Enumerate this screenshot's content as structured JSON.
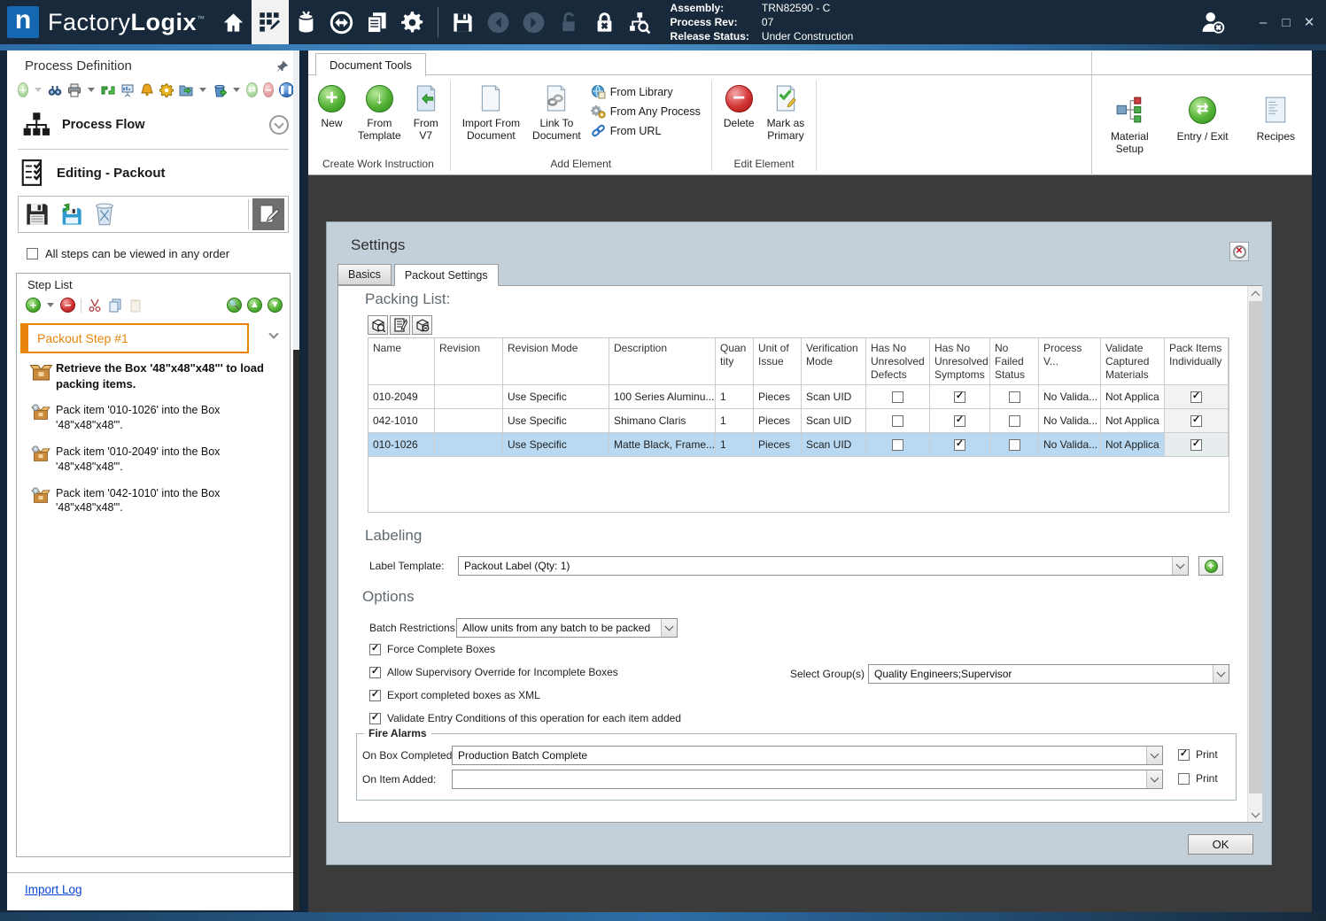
{
  "titlebar": {
    "brand_light": "Factory",
    "brand_bold": "Logix",
    "brand_tm": "™",
    "logo_letter": "n",
    "assembly_label": "Assembly:",
    "assembly_value": "TRN82590 - C",
    "process_rev_label": "Process Rev:",
    "process_rev_value": "07",
    "release_status_label": "Release Status:",
    "release_status_value": "Under Construction",
    "minimize_glyph": "–",
    "maximize_glyph": "□",
    "close_glyph": "✕"
  },
  "ribbon": {
    "tab_label": "Document Tools",
    "groups": [
      {
        "label": "Create Work Instruction",
        "buttons": [
          {
            "label": "New"
          },
          {
            "label": "From\nTemplate"
          },
          {
            "label": "From\nV7"
          }
        ]
      },
      {
        "label": "Add Element",
        "buttons": [
          {
            "label": "Import From\nDocument"
          },
          {
            "label": "Link To\nDocument"
          }
        ],
        "menu_items": [
          {
            "label": "From Library"
          },
          {
            "label": "From Any Process"
          },
          {
            "label": "From URL"
          }
        ]
      },
      {
        "label": "Edit Element",
        "buttons": [
          {
            "label": "Delete"
          },
          {
            "label": "Mark as\nPrimary"
          }
        ]
      }
    ],
    "right_buttons": [
      {
        "label": "Material\nSetup"
      },
      {
        "label": "Entry / Exit"
      },
      {
        "label": "Recipes"
      }
    ]
  },
  "left_panel": {
    "title": "Process Definition",
    "process_flow_label": "Process Flow",
    "editing_label": "Editing - Packout",
    "all_steps_checkbox_label": "All steps can be viewed in any order",
    "all_steps_checked": false,
    "step_list": {
      "title": "Step List",
      "selected_step": "Packout Step #1",
      "items": [
        {
          "icon": "retrieve-box-icon",
          "bold": true,
          "text": "Retrieve the Box '48\"x48\"x48\"' to load packing items."
        },
        {
          "icon": "pack-item-icon",
          "bold": false,
          "text": "Pack item '010-1026' into the Box '48\"x48\"x48\"'."
        },
        {
          "icon": "pack-item-icon",
          "bold": false,
          "text": "Pack item '010-2049' into the Box '48\"x48\"x48\"'."
        },
        {
          "icon": "pack-item-icon",
          "bold": false,
          "text": "Pack item '042-1010' into the Box '48\"x48\"x48\"'."
        }
      ]
    },
    "import_log_link": "Import Log"
  },
  "dialog": {
    "title": "Settings",
    "tabs": [
      "Basics",
      "Packout Settings"
    ],
    "active_tab": "Packout Settings",
    "packing_list": {
      "heading": "Packing List:",
      "columns": [
        "Name",
        "Revision",
        "Revision Mode",
        "Description",
        "Quantity",
        "Unit of Issue",
        "Verification Mode",
        "Has No Unresolved Defects",
        "Has No Unresolved Symptoms",
        "No Failed Status",
        "Process V...",
        "Validate Captured Materials",
        "Pack Items Individually"
      ],
      "rows": [
        {
          "name": "010-2049",
          "revision": "",
          "revision_mode": "Use Specific",
          "description": "100 Series Aluminu...",
          "quantity": "1",
          "unit_of_issue": "Pieces",
          "verification_mode": "Scan UID",
          "has_no_unresolved_defects": false,
          "has_no_unresolved_symptoms": true,
          "no_failed_status": false,
          "process_validation": "No Valida...",
          "validate_captured_materials": "Not Applica",
          "pack_items_individually": true,
          "selected": false
        },
        {
          "name": "042-1010",
          "revision": "",
          "revision_mode": "Use Specific",
          "description": "Shimano Claris",
          "quantity": "1",
          "unit_of_issue": "Pieces",
          "verification_mode": "Scan UID",
          "has_no_unresolved_defects": false,
          "has_no_unresolved_symptoms": true,
          "no_failed_status": false,
          "process_validation": "No Valida...",
          "validate_captured_materials": "Not Applica",
          "pack_items_individually": true,
          "selected": false
        },
        {
          "name": "010-1026",
          "revision": "",
          "revision_mode": "Use Specific",
          "description": "Matte Black, Frame...",
          "quantity": "1",
          "unit_of_issue": "Pieces",
          "verification_mode": "Scan UID",
          "has_no_unresolved_defects": false,
          "has_no_unresolved_symptoms": true,
          "no_failed_status": false,
          "process_validation": "No Valida...",
          "validate_captured_materials": "Not Applica",
          "pack_items_individually": true,
          "selected": true
        }
      ]
    },
    "labeling": {
      "heading": "Labeling",
      "label_template_label": "Label Template:",
      "label_template_value": "Packout Label (Qty: 1)"
    },
    "options": {
      "heading": "Options",
      "batch_restrictions_label": "Batch Restrictions:",
      "batch_restrictions_value": "Allow units from any batch to be packed",
      "checkboxes": [
        {
          "label": "Force Complete Boxes",
          "checked": true
        },
        {
          "label": "Allow Supervisory Override for Incomplete Boxes",
          "checked": true
        },
        {
          "label": "Export completed boxes as XML",
          "checked": true
        },
        {
          "label": "Validate Entry Conditions of this operation for each item added",
          "checked": true
        }
      ],
      "select_groups_label": "Select Group(s)",
      "select_groups_value": "Quality Engineers;Supervisor"
    },
    "fire_alarms": {
      "heading": "Fire Alarms",
      "on_box_completed_label": "On Box Completed:",
      "on_box_completed_value": "Production Batch Complete",
      "on_box_print_label": "Print",
      "on_box_print_checked": true,
      "on_item_added_label": "On Item Added:",
      "on_item_added_value": "",
      "on_item_print_label": "Print",
      "on_item_print_checked": false
    },
    "ok_button_label": "OK"
  },
  "icons": {
    "home-icon": "house",
    "process-editor-icon": "grid+pencil",
    "materials-icon": "cylinder",
    "transfer-icon": "circle-arrows",
    "documents-icon": "stacked-pages",
    "settings-gear-icon": "gear",
    "save-icon": "floppy",
    "back-icon": "circle-left-arrow",
    "forward-icon": "circle-right-arrow",
    "unlock-icon": "open-padlock",
    "lock-x-icon": "padlock-x",
    "process-search-icon": "hierarchy+magnifier",
    "user-status-icon": "person+x-badge",
    "pin-icon": "pushpin",
    "process-flow-icon": "hierarchy",
    "editing-checklist-icon": "checklist-page",
    "retrieve-box-icon": "open-carton",
    "pack-item-icon": "carton+part"
  }
}
